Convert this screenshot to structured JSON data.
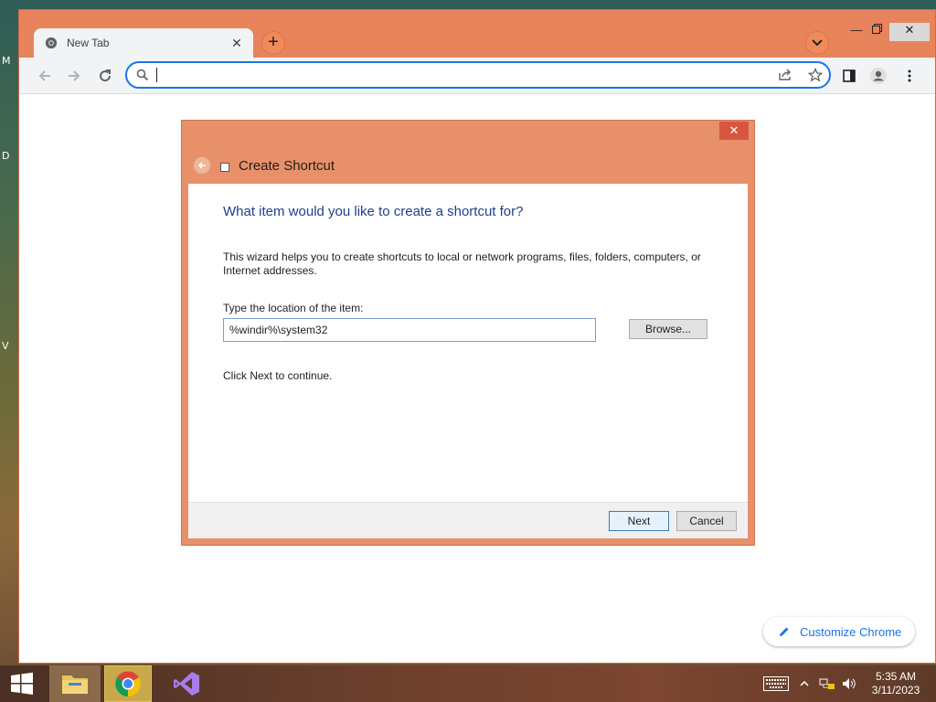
{
  "desktop": {
    "side_letters": [
      "M",
      "D",
      "V"
    ]
  },
  "browser": {
    "tab": {
      "title": "New Tab"
    },
    "address_bar": {
      "value": "",
      "placeholder": ""
    },
    "customize_label": "Customize Chrome",
    "colors": {
      "theme": "#e8845c",
      "accent": "#1a73e8"
    }
  },
  "wizard": {
    "title": "Create Shortcut",
    "heading": "What item would you like to create a shortcut for?",
    "description": "This wizard helps you to create shortcuts to local or network programs, files, folders, computers, or Internet addresses.",
    "location_label": "Type the location of the item:",
    "location_value": "%windir%\\system32",
    "browse_label": "Browse...",
    "hint": "Click Next to continue.",
    "next_label": "Next",
    "cancel_label": "Cancel"
  },
  "taskbar": {
    "pinned": [
      "file-explorer",
      "chrome",
      "visual-studio"
    ],
    "clock": {
      "time": "5:35 AM",
      "date": "3/11/2023"
    }
  }
}
